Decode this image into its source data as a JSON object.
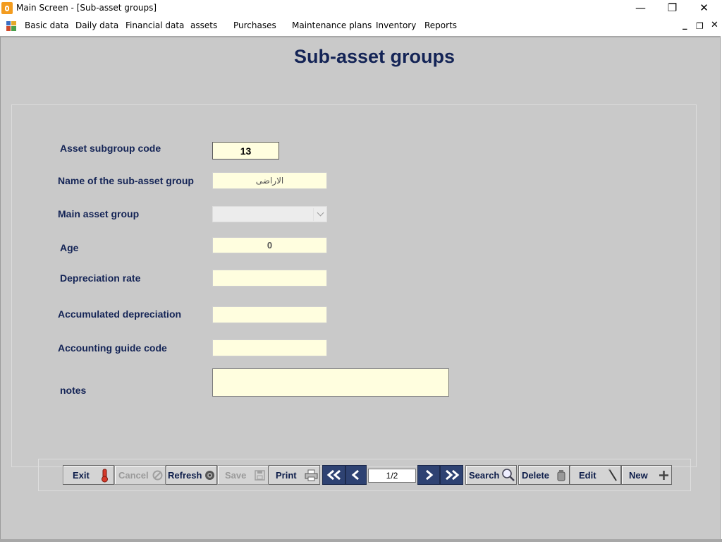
{
  "window": {
    "title": "Main Screen - [Sub-asset groups]"
  },
  "menu": {
    "items": [
      "Basic data",
      "Daily data",
      "Financial data",
      "assets",
      "Purchases",
      "Maintenance plans",
      "Inventory",
      "Reports"
    ]
  },
  "form": {
    "title": "Sub-asset groups",
    "labels": {
      "code": "Asset subgroup code",
      "name": "Name of the sub-asset group",
      "main_group": "Main asset group",
      "age": "Age",
      "depreciation_rate": "Depreciation rate",
      "accumulated_depreciation": "Accumulated depreciation",
      "accounting_code": "Accounting guide code",
      "notes": "notes"
    },
    "values": {
      "code": "13",
      "name": "الاراضى",
      "main_group": "",
      "age": "0",
      "depreciation_rate": "",
      "accumulated_depreciation": "",
      "accounting_code": "",
      "notes": ""
    }
  },
  "toolbar": {
    "exit": "Exit",
    "cancel": "Cancel",
    "refresh": "Refresh",
    "save": "Save",
    "print": "Print",
    "pager": "1/2",
    "search": "Search",
    "delete": "Delete",
    "edit": "Edit",
    "new": "New"
  },
  "colors": {
    "label": "#142456",
    "field_bg": "#fffedf",
    "client_bg": "#c9c9c9",
    "nav_button": "#2e4272"
  }
}
